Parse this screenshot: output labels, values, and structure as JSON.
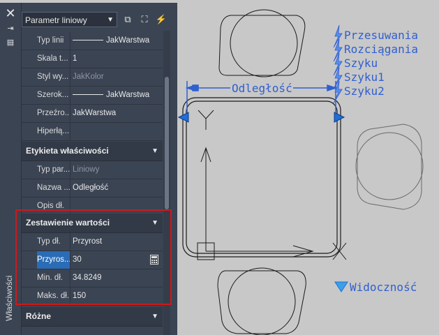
{
  "palette": {
    "title": "Właściwości",
    "object_select": "Parametr liniowy",
    "toolbar_icons": [
      "select-objects-icon",
      "quick-select-icon",
      "toggle-pickadd-icon"
    ]
  },
  "sections": {
    "general_rows": [
      {
        "name": "Typ linii",
        "value": "JakWarstwa",
        "swatch": true
      },
      {
        "name": "Skala t...",
        "value": "1"
      },
      {
        "name": "Styl wy...",
        "value": "JakKolor",
        "dim": true
      },
      {
        "name": "Szerok...",
        "value": "JakWarstwa",
        "swatch": true
      },
      {
        "name": "Przeźro...",
        "value": "JakWarstwa"
      },
      {
        "name": "Hiperłą...",
        "value": ""
      }
    ],
    "label": {
      "title": "Etykieta właściwości",
      "rows": [
        {
          "name": "Typ par...",
          "value": "Liniowy",
          "dim": true
        },
        {
          "name": "Nazwa ...",
          "value": "Odległość"
        },
        {
          "name": "Opis dł.",
          "value": ""
        }
      ]
    },
    "value_set": {
      "title": "Zestawienie wartości",
      "rows": [
        {
          "name": "Typ dł.",
          "value": "Przyrost"
        },
        {
          "name": "Przyros...",
          "value": "30",
          "selected": true
        },
        {
          "name": "Min. dł.",
          "value": "34.8249"
        },
        {
          "name": "Maks. dł.",
          "value": "150"
        }
      ]
    },
    "misc": {
      "title": "Różne"
    }
  },
  "drawing": {
    "dimension_label": "Odległość",
    "action_labels": [
      "Przesuwania",
      "Rozciągania",
      "Szyku",
      "Szyku1",
      "Szyku2"
    ],
    "visibility_label": "Widoczność",
    "accent": "#2f5fd0",
    "grip_color": "#1e6fd6"
  }
}
